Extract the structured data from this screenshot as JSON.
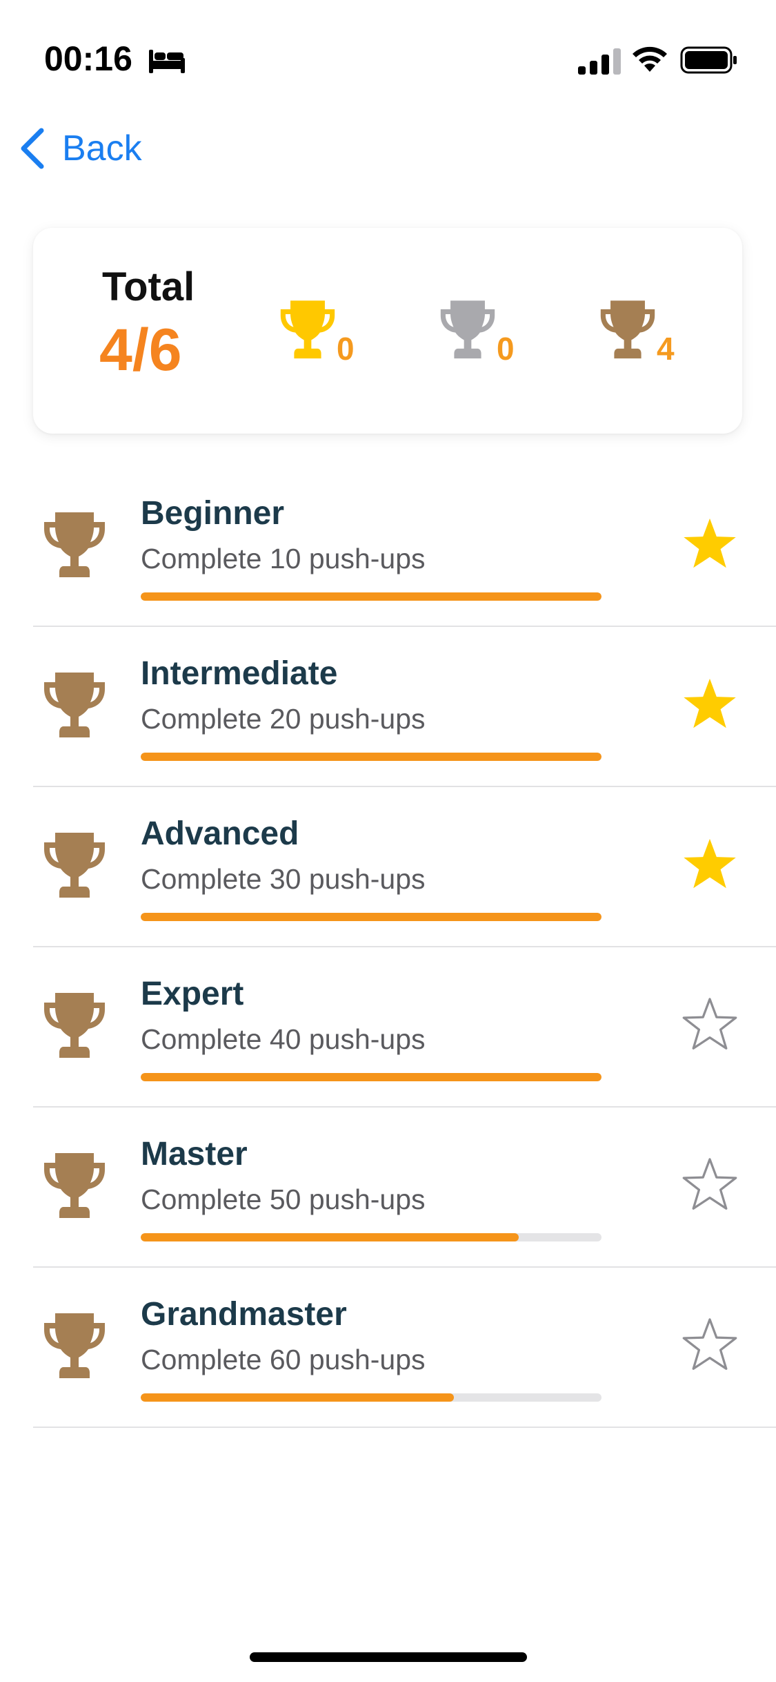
{
  "status_bar": {
    "time": "00:16",
    "icons": [
      "bed-icon",
      "cellular-signal-icon",
      "wifi-icon",
      "battery-icon"
    ]
  },
  "nav": {
    "back_label": "Back",
    "back_icon": "chevron-left-icon"
  },
  "summary": {
    "total_label": "Total",
    "total_value": "4/6",
    "gold": {
      "icon": "gold-trophy-icon",
      "count": "0",
      "color": "#ffc800"
    },
    "silver": {
      "icon": "silver-trophy-icon",
      "count": "0",
      "color": "#a9a9ad"
    },
    "bronze": {
      "icon": "bronze-trophy-icon",
      "count": "4",
      "color": "#a57f53"
    }
  },
  "achievements": [
    {
      "title": "Beginner",
      "description": "Complete 10 push-ups",
      "progress": 1.0,
      "starred": true,
      "trophy": "bronze"
    },
    {
      "title": "Intermediate",
      "description": "Complete 20 push-ups",
      "progress": 1.0,
      "starred": true,
      "trophy": "bronze"
    },
    {
      "title": "Advanced",
      "description": "Complete 30 push-ups",
      "progress": 1.0,
      "starred": true,
      "trophy": "bronze"
    },
    {
      "title": "Expert",
      "description": "Complete 40 push-ups",
      "progress": 1.0,
      "starred": false,
      "trophy": "bronze"
    },
    {
      "title": "Master",
      "description": "Complete 50 push-ups",
      "progress": 0.82,
      "starred": false,
      "trophy": "bronze"
    },
    {
      "title": "Grandmaster",
      "description": "Complete 60 push-ups",
      "progress": 0.68,
      "starred": false,
      "trophy": "bronze"
    }
  ],
  "colors": {
    "accent_blue": "#1a7ef0",
    "accent_orange": "#f5841f",
    "progress_fill": "#f5941a",
    "star_filled": "#ffcc00",
    "star_outline": "#8e8e93",
    "title_text": "#1c3a4a"
  }
}
